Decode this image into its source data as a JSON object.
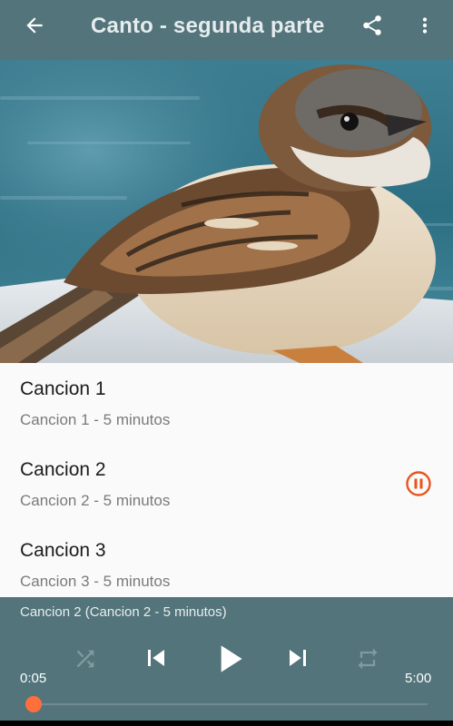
{
  "toolbar": {
    "title": "Canto - segunda parte",
    "back_icon": "arrow-back-icon",
    "share_icon": "share-icon",
    "more_icon": "more-vert-icon"
  },
  "header_image": {
    "subject": "sparrow-photo"
  },
  "songs": [
    {
      "title": "Cancion 1",
      "subtitle": "Cancion 1 - 5 minutos",
      "playing": false
    },
    {
      "title": "Cancion 2",
      "subtitle": "Cancion 2 - 5 minutos",
      "playing": true
    },
    {
      "title": "Cancion 3",
      "subtitle": "Cancion 3 - 5 minutos",
      "playing": false
    }
  ],
  "player": {
    "now_playing": "Cancion 2 (Cancion 2 - 5 minutos)",
    "elapsed": "0:05",
    "duration": "5:00",
    "progress": 0.0,
    "controls": [
      "shuffle-icon",
      "skip-previous-icon",
      "play-icon",
      "skip-next-icon",
      "repeat-icon"
    ]
  },
  "colors": {
    "primary": "#52747a",
    "accent": "#ff6f3c",
    "pause_accent": "#e8541e"
  }
}
